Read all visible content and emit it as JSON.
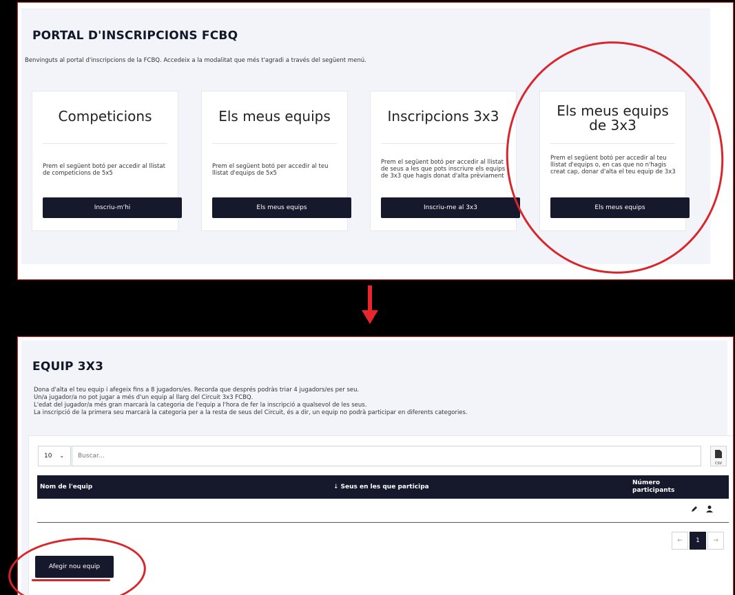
{
  "top_panel": {
    "title": "PORTAL D'INSCRIPCIONS FCBQ",
    "intro": "Benvinguts al portal d'inscripcions de la FCBQ. Accedeix a la modalitat que més t'agradi a través del següent menú.",
    "cards": [
      {
        "title": "Competicions",
        "text": "Prem el següent botó per accedir al llistat de competicions de 5x5",
        "button": "Inscriu-m'hi"
      },
      {
        "title": "Els meus equips",
        "text": "Prem el següent botó per accedir al teu llistat d'equips de 5x5",
        "button": "Els meus equips"
      },
      {
        "title": "Inscripcions 3x3",
        "text": "Prem el següent botó per accedir al llistat de seus a les que pots inscriure els equips de 3x3 que hagis donat d'alta prèviament",
        "button": "Inscriu-me al 3x3"
      },
      {
        "title": "Els meus equips de 3x3",
        "text": "Prem el següent botó per accedir al teu llistat d'equips o, en cas que no n'hagis creat cap, donar d'alta el teu equip de 3x3",
        "button": "Els meus equips"
      }
    ]
  },
  "bottom_panel": {
    "title": "EQUIP 3X3",
    "intro_lines": [
      "Dona d'alta el teu equip i afegeix fins a 8 jugadors/es. Recorda que després podràs triar 4 jugadors/es per seu.",
      "Un/a jugador/a no pot jugar a més d'un equip al llarg del Circuit 3x3 FCBQ.",
      "L'edat del jugador/a més gran marcarà la categoria de l'equip a l'hora de fer la inscripció a qualsevol de les seus.",
      "La inscripció de la primera seu marcarà la categoria per a la resta de seus del Circuit, és a dir, un equip no podrà participar en diferents categories."
    ],
    "page_length": "10",
    "search_placeholder": "Buscar...",
    "csv_label": "CSV",
    "columns": [
      "Nom de l'equip",
      "Seus en les que participa",
      "Número participants"
    ],
    "sort_indicator": "↓",
    "pagination": {
      "prev": "←",
      "current": "1",
      "next": "→"
    },
    "add_button": "Afegir nou equip"
  },
  "colors": {
    "accent_red": "#d8262b",
    "dark_navy": "#16182c",
    "panel_bg": "#f2f4f9"
  }
}
